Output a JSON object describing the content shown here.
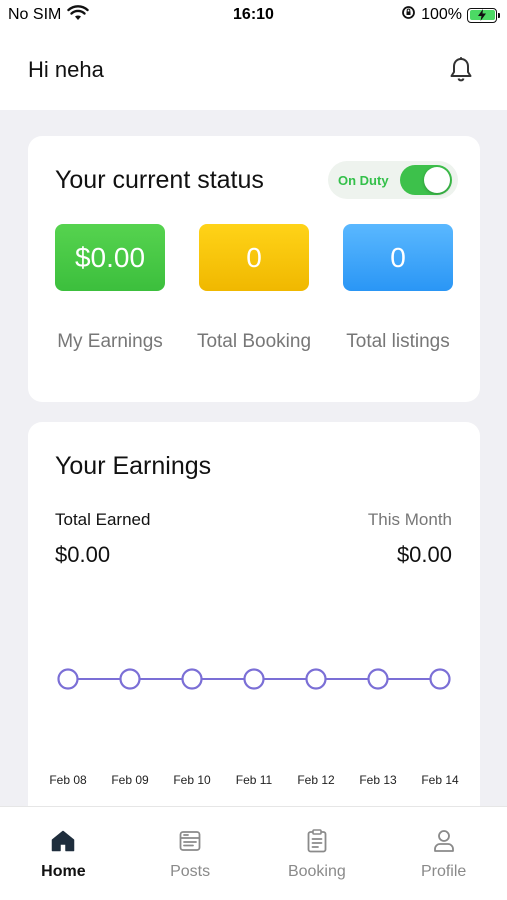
{
  "status_bar": {
    "carrier": "No SIM",
    "time": "16:10",
    "battery": "100%"
  },
  "header": {
    "greeting": "Hi neha",
    "icon": "bell-icon"
  },
  "status_card": {
    "title": "Your current status",
    "duty_label": "On Duty",
    "duty_on": true,
    "stats": [
      {
        "value": "$0.00",
        "label": "My Earnings",
        "color": "#47c944"
      },
      {
        "value": "0",
        "label": "Total Booking",
        "color": "#f7c60a"
      },
      {
        "value": "0",
        "label": "Total listings",
        "color": "#3aa6fa"
      }
    ]
  },
  "earnings_card": {
    "title": "Your Earnings",
    "total_label": "Total Earned",
    "total_value": "$0.00",
    "month_label": "This Month",
    "month_value": "$0.00"
  },
  "chart_data": {
    "type": "line",
    "x": [
      "Feb 08",
      "Feb 09",
      "Feb 10",
      "Feb 11",
      "Feb 12",
      "Feb 13",
      "Feb 14"
    ],
    "series": [
      {
        "values": [
          0,
          0,
          0,
          0,
          0,
          0,
          0
        ]
      }
    ],
    "line_color": "#7b6fd6",
    "grid": false
  },
  "tabs": [
    {
      "label": "Home",
      "icon": "home-icon",
      "active": true
    },
    {
      "label": "Posts",
      "icon": "posts-icon",
      "active": false
    },
    {
      "label": "Booking",
      "icon": "booking-icon",
      "active": false
    },
    {
      "label": "Profile",
      "icon": "profile-icon",
      "active": false
    }
  ]
}
